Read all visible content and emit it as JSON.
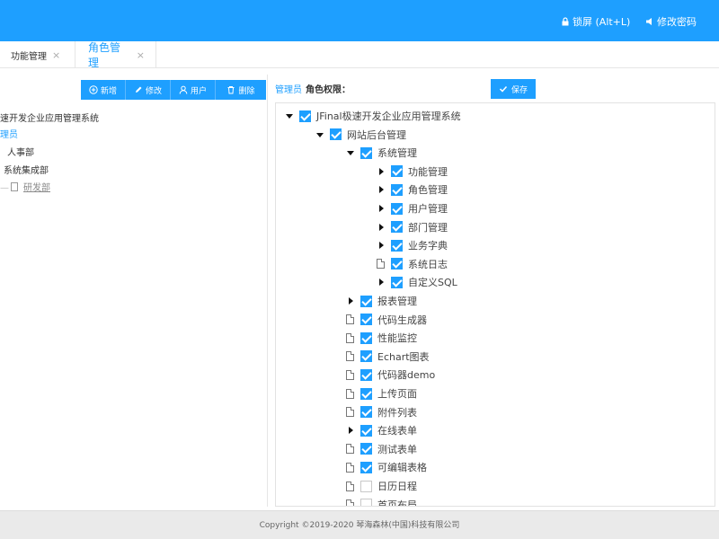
{
  "header": {
    "lock_label": "锁屏 (Alt+L)",
    "password_label": "修改密码",
    "background_color": "#1e9fff"
  },
  "tabs": [
    {
      "label": "功能管理",
      "close": "×"
    },
    {
      "label": "角色管理",
      "close": "×",
      "active": true
    }
  ],
  "toolbar": {
    "add_label": "新增",
    "edit_label": "修改",
    "user_label": "用户",
    "delete_label": "删除"
  },
  "left_tree": {
    "nodes": [
      {
        "label": "速开发企业应用管理系统"
      },
      {
        "label": "理员",
        "selected": true
      },
      {
        "label": "人事部"
      },
      {
        "label": "系统集成部"
      },
      {
        "label": "研发部"
      }
    ]
  },
  "right": {
    "role_name": "管理员",
    "role_label": "角色权限：",
    "save_label": "保存"
  },
  "perm_tree": [
    {
      "label": "JFinal极速开发企业应用管理系统",
      "expander": "down",
      "checked": true
    },
    {
      "label": "网站后台管理",
      "expander": "down",
      "checked": true
    },
    {
      "label": "系统管理",
      "expander": "down",
      "checked": true
    },
    {
      "label": "功能管理",
      "expander": "right",
      "checked": true
    },
    {
      "label": "角色管理",
      "expander": "right",
      "checked": true
    },
    {
      "label": "用户管理",
      "expander": "right",
      "checked": true
    },
    {
      "label": "部门管理",
      "expander": "right",
      "checked": true
    },
    {
      "label": "业务字典",
      "expander": "right",
      "checked": true
    },
    {
      "label": "系统日志",
      "expander": "file",
      "checked": true
    },
    {
      "label": "自定义SQL",
      "expander": "right",
      "checked": true
    },
    {
      "label": "报表管理",
      "expander": "right",
      "checked": true
    },
    {
      "label": "代码生成器",
      "expander": "file",
      "checked": true
    },
    {
      "label": "性能监控",
      "expander": "file",
      "checked": true
    },
    {
      "label": "Echart图表",
      "expander": "file",
      "checked": true
    },
    {
      "label": "代码器demo",
      "expander": "file",
      "checked": true
    },
    {
      "label": "上传页面",
      "expander": "file",
      "checked": true
    },
    {
      "label": "附件列表",
      "expander": "file",
      "checked": true
    },
    {
      "label": "在线表单",
      "expander": "right",
      "checked": true
    },
    {
      "label": "测试表单",
      "expander": "file",
      "checked": true
    },
    {
      "label": "可编辑表格",
      "expander": "file",
      "checked": true
    },
    {
      "label": "日历日程",
      "expander": "file",
      "checked": false
    },
    {
      "label": "首页布局",
      "expander": "file",
      "checked": false
    }
  ],
  "footer": {
    "copyright": "Copyright ©2019-2020 琴海森林(中国)科技有限公司"
  }
}
